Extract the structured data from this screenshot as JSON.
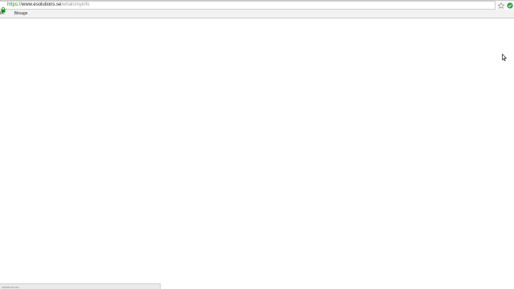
{
  "address_bar": {
    "scheme": "https://",
    "host": "www.esolutions.se",
    "path": "/whatsmyinfo"
  },
  "bookmarks_bar": {
    "apps_label": "IA",
    "items": [
      {
        "label": "Bitsage",
        "icon": "folder-icon"
      }
    ]
  },
  "status_bar": {
    "text": "solutions.se..."
  },
  "colors": {
    "secure_scheme": "#1a8f1a",
    "extension_icon": "#2e9e3e",
    "page_background": "#ffffff"
  },
  "icons": {
    "lock": "lock-icon",
    "bookmark_star": "star-icon",
    "extension": "extension-icon",
    "cursor": "mouse-cursor-icon"
  }
}
